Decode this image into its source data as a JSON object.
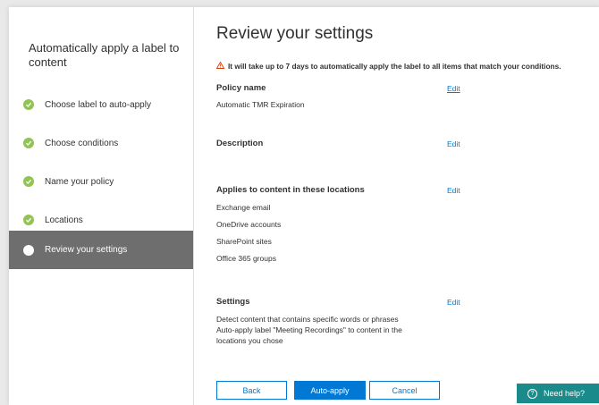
{
  "wizard": {
    "title": "Automatically apply a label to content",
    "steps": [
      {
        "label": "Choose label to auto-apply",
        "state": "done"
      },
      {
        "label": "Choose conditions",
        "state": "done"
      },
      {
        "label": "Name your policy",
        "state": "done"
      },
      {
        "label": "Locations",
        "state": "done"
      },
      {
        "label": "Review your settings",
        "state": "active"
      }
    ]
  },
  "review": {
    "title": "Review your settings",
    "warning": "It will take up to 7 days to automatically apply the label to all items that match your conditions.",
    "edit_label": "Edit",
    "policy_name": {
      "heading": "Policy name",
      "value": "Automatic TMR Expiration"
    },
    "description": {
      "heading": "Description"
    },
    "locations": {
      "heading": "Applies to content in these locations",
      "items": [
        "Exchange email",
        "OneDrive accounts",
        "SharePoint sites",
        "Office 365 groups"
      ]
    },
    "settings": {
      "heading": "Settings",
      "lines": [
        "Detect content that contains specific words or phrases",
        "Auto-apply label \"Meeting Recordings\" to content in the",
        "locations you chose"
      ]
    }
  },
  "footer": {
    "back_label": "Back",
    "autoapply_label": "Auto-apply",
    "cancel_label": "Cancel",
    "help_label": "Need help?"
  },
  "colors": {
    "accent": "#0078d4",
    "done": "#92c353",
    "active_step_bg": "#6e6e6e",
    "warning": "#d83b01",
    "help": "#1b8a8a"
  },
  "icons": {
    "step_done": "checkmark-circle-icon",
    "step_active": "dot-icon",
    "warning": "warning-triangle-icon",
    "help": "question-circle-icon"
  }
}
